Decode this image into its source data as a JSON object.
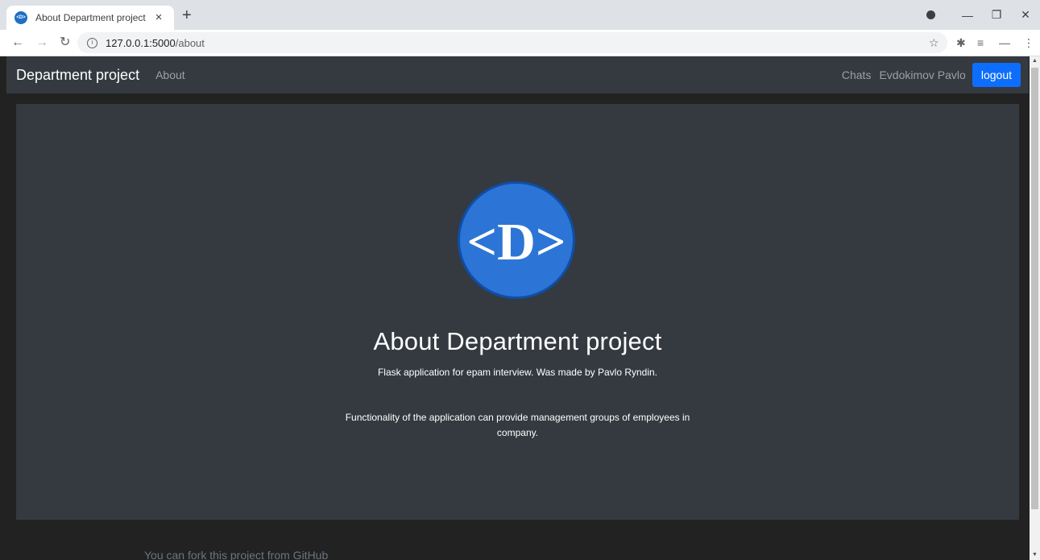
{
  "browser": {
    "tab_title": "About Department project",
    "tab_close": "×",
    "new_tab": "+",
    "url_host": "127.0.0.1:5000",
    "url_path": "/about",
    "window_controls": {
      "minimize": "—",
      "restore": "❐",
      "close": "✕"
    }
  },
  "navbar": {
    "brand": "Department project",
    "about_link": "About",
    "chats_link": "Chats",
    "user_name": "Evdokimov Pavlo",
    "logout_label": "logout"
  },
  "jumbotron": {
    "logo_text": "<D>",
    "title": "About Department project",
    "subtitle": "Flask application for epam interview. Was made by Pavlo Ryndin.",
    "description": "Functionality of the application can provide management groups of employees in company."
  },
  "footer": {
    "text": "You can fork this project from GitHub"
  },
  "colors": {
    "navbar_bg": "#343a40",
    "page_bg": "#222222",
    "logout_button": "#0d6efd",
    "logo_circle": "#2c75d6"
  },
  "icons": [
    "back-arrow-icon",
    "forward-arrow-icon",
    "reload-icon",
    "info-icon",
    "star-icon",
    "extensions-icon",
    "reading-list-icon",
    "profile-icon",
    "menu-icon",
    "record-icon"
  ]
}
